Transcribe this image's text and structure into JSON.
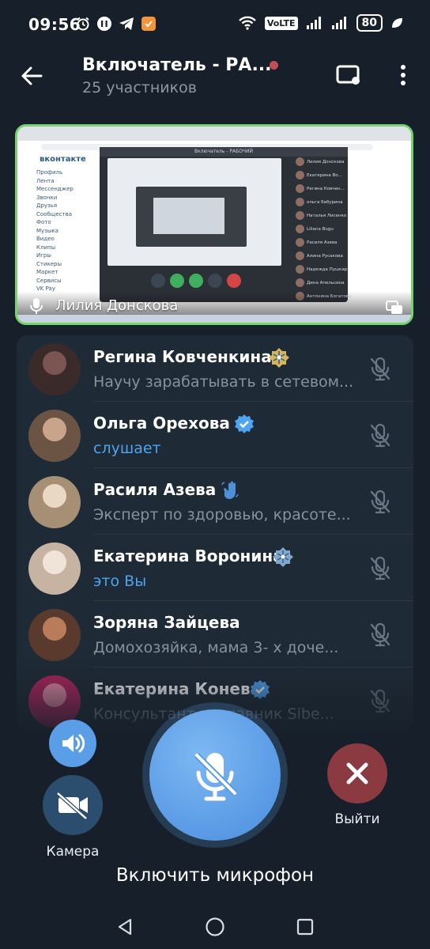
{
  "status_bar": {
    "time": "09:56",
    "volte": "VoLTE",
    "battery": "80"
  },
  "header": {
    "title": "Включатель - РА...",
    "subtitle": "25 участников",
    "live_color": "#c24d57"
  },
  "video": {
    "speaker_name": "Лилия Донскова",
    "border_color": "#74d36c",
    "inner_window_title": "Включатель - РАБОЧИЙ",
    "inner_brand": "вконтакте",
    "inner_menu": [
      "Профиль",
      "Лента",
      "Мессенджер",
      "Звонки",
      "Друзья",
      "Сообщества",
      "Фото",
      "Музыка",
      "Видео",
      "Клипы",
      "Игры",
      "Стикеры",
      "Маркет",
      "Сервисы",
      "VK Pay"
    ],
    "inner_participants": [
      "Лилия Донскова",
      "Екатерина Во...",
      "Регина Ковчен...",
      "ольга бабурина",
      "Наталья Лисенко",
      "Liliana Bugu",
      "Расиля Азева",
      "Алина Русакова",
      "Надежда Пушкар...",
      "Дина Апельсина",
      "Антонина Богатова"
    ]
  },
  "participants": [
    {
      "name": "Регина Ковченкина",
      "status": "Научу зарабатывать в сетевом...",
      "status_style": "gray",
      "badge": "snowflake-badge-gold",
      "avatar": [
        "#3b2a2a",
        "#7a5552"
      ]
    },
    {
      "name": "Ольга Орехова",
      "status": "слушает",
      "status_style": "blue",
      "badge": "verified-badge",
      "avatar": [
        "#6b5444",
        "#c9a48a"
      ]
    },
    {
      "name": "Расиля Азева",
      "status": "Эксперт по здоровью, красоте...",
      "status_style": "gray",
      "badge": "waving-hand-badge",
      "avatar": [
        "#a78f76",
        "#e8d8c4"
      ]
    },
    {
      "name": "Екатерина Воронина",
      "status": "это Вы",
      "status_style": "blue",
      "badge": "snowflake-badge-blue",
      "avatar": [
        "#c7b3a1",
        "#f0e4d8"
      ]
    },
    {
      "name": "Зоряна Зайцева",
      "status": "Домохозяйка, мама 3- х доче...",
      "status_style": "gray",
      "badge": "",
      "avatar": [
        "#5a3a2c",
        "#b97c5a"
      ]
    },
    {
      "name": "Екатерина Конева",
      "status": "Консультант наставник Sibe...",
      "status_style": "gray",
      "badge": "verified-badge",
      "avatar": [
        "#b3245e",
        "#e98aa6"
      ]
    }
  ],
  "controls": {
    "camera_label": "Камера",
    "exit_label": "Выйти",
    "mic_label": "Включить микрофон"
  }
}
